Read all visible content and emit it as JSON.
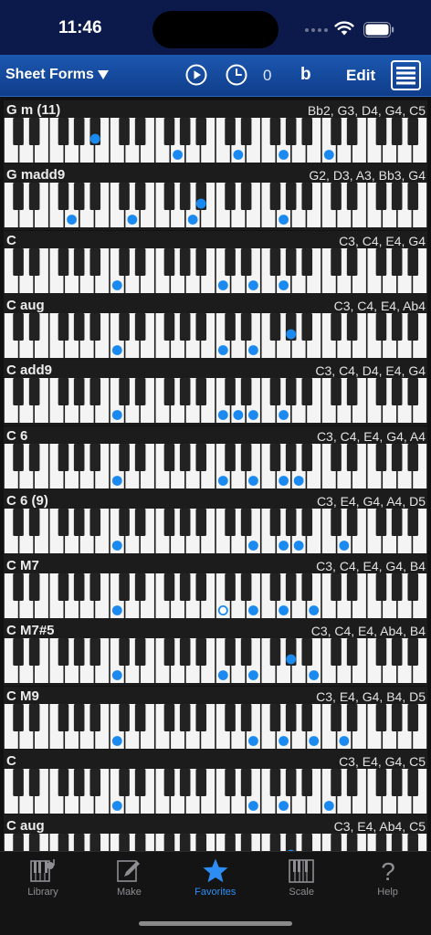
{
  "status": {
    "time": "11:46"
  },
  "nav": {
    "title": "Sheet Forms",
    "count": "0",
    "flat_label": "b",
    "edit_label": "Edit"
  },
  "colors": {
    "accent": "#1a8af0",
    "nav_top": "#1c58b0",
    "tab_active": "#2d8df2"
  },
  "chords": [
    {
      "name": "G m (11)",
      "notes": "Bb2, G3, D4, G4, C5",
      "keys": [
        [
          "Bb2",
          "filled"
        ],
        [
          "G3",
          "filled"
        ],
        [
          "D4",
          "filled"
        ],
        [
          "G4",
          "filled"
        ],
        [
          "C5",
          "filled"
        ]
      ]
    },
    {
      "name": "G madd9",
      "notes": "G2, D3, A3, Bb3, G4",
      "keys": [
        [
          "G2",
          "filled"
        ],
        [
          "D3",
          "filled"
        ],
        [
          "A3",
          "filled"
        ],
        [
          "Bb3",
          "filled"
        ],
        [
          "G4",
          "filled"
        ]
      ]
    },
    {
      "name": "C",
      "notes": "C3, C4, E4, G4",
      "keys": [
        [
          "C3",
          "filled"
        ],
        [
          "C4",
          "filled"
        ],
        [
          "E4",
          "filled"
        ],
        [
          "G4",
          "filled"
        ]
      ]
    },
    {
      "name": "C aug",
      "notes": "C3, C4, E4, Ab4",
      "keys": [
        [
          "C3",
          "filled"
        ],
        [
          "C4",
          "filled"
        ],
        [
          "E4",
          "filled"
        ],
        [
          "Ab4",
          "filled"
        ]
      ]
    },
    {
      "name": "C add9",
      "notes": "C3, C4, D4, E4, G4",
      "keys": [
        [
          "C3",
          "filled"
        ],
        [
          "C4",
          "filled"
        ],
        [
          "D4",
          "filled"
        ],
        [
          "E4",
          "filled"
        ],
        [
          "G4",
          "filled"
        ]
      ]
    },
    {
      "name": "C 6",
      "notes": "C3, C4, E4, G4, A4",
      "keys": [
        [
          "C3",
          "filled"
        ],
        [
          "C4",
          "filled"
        ],
        [
          "E4",
          "filled"
        ],
        [
          "G4",
          "filled"
        ],
        [
          "A4",
          "filled"
        ]
      ]
    },
    {
      "name": "C 6 (9)",
      "notes": "C3, E4, G4, A4, D5",
      "keys": [
        [
          "C3",
          "filled"
        ],
        [
          "E4",
          "filled"
        ],
        [
          "G4",
          "filled"
        ],
        [
          "A4",
          "filled"
        ],
        [
          "D5",
          "filled"
        ]
      ]
    },
    {
      "name": "C M7",
      "notes": "C3, C4, E4, G4, B4",
      "keys": [
        [
          "C3",
          "filled"
        ],
        [
          "C4",
          "hollow"
        ],
        [
          "E4",
          "filled"
        ],
        [
          "G4",
          "filled"
        ],
        [
          "B4",
          "filled"
        ]
      ]
    },
    {
      "name": "C M7#5",
      "notes": "C3, C4, E4, Ab4, B4",
      "keys": [
        [
          "C3",
          "filled"
        ],
        [
          "C4",
          "filled"
        ],
        [
          "E4",
          "filled"
        ],
        [
          "Ab4",
          "filled"
        ],
        [
          "B4",
          "filled"
        ]
      ]
    },
    {
      "name": "C M9",
      "notes": "C3, E4, G4, B4, D5",
      "keys": [
        [
          "C3",
          "filled"
        ],
        [
          "E4",
          "filled"
        ],
        [
          "G4",
          "filled"
        ],
        [
          "B4",
          "filled"
        ],
        [
          "D5",
          "filled"
        ]
      ]
    },
    {
      "name": "C",
      "notes": "C3, E4, G4, C5",
      "keys": [
        [
          "C3",
          "filled"
        ],
        [
          "E4",
          "filled"
        ],
        [
          "G4",
          "filled"
        ],
        [
          "C5",
          "filled"
        ]
      ]
    },
    {
      "name": "C aug",
      "notes": "C3, E4, Ab4, C5",
      "keys": [
        [
          "C3",
          "filled"
        ],
        [
          "E4",
          "filled"
        ],
        [
          "Ab4",
          "filled"
        ],
        [
          "C5",
          "filled"
        ]
      ]
    }
  ],
  "tabs": [
    {
      "label": "Library",
      "icon": "library-icon",
      "active": false
    },
    {
      "label": "Make",
      "icon": "pencil-icon",
      "active": false
    },
    {
      "label": "Favorites",
      "icon": "star-icon",
      "active": true
    },
    {
      "label": "Scale",
      "icon": "scale-icon",
      "active": false
    },
    {
      "label": "Help",
      "icon": "help-icon",
      "active": false
    }
  ]
}
